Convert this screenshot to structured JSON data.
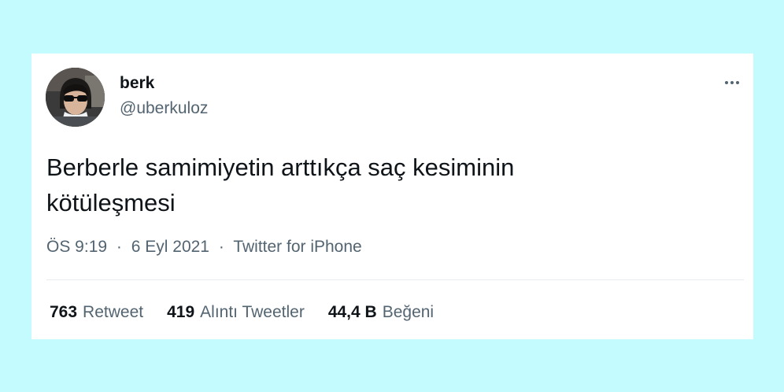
{
  "tweet": {
    "author": {
      "name": "berk",
      "handle": "@uberkuloz",
      "avatar_icon": "profile-photo"
    },
    "more_icon": "more-horizontal-icon",
    "text_line1": "Berberle samimiyetin arttıkça saç kesiminin",
    "text_line2": "kötüleşmesi",
    "meta": {
      "time": "ÖS 9:19",
      "separator": "·",
      "date": "6 Eyl 2021",
      "source": "Twitter for iPhone"
    },
    "stats": {
      "retweets": {
        "count": "763",
        "label": "Retweet"
      },
      "quotes": {
        "count": "419",
        "label": "Alıntı Tweetler"
      },
      "likes": {
        "count": "44,4 B",
        "label": "Beğeni"
      }
    }
  },
  "colors": {
    "background": "#c3fbff",
    "card": "#ffffff",
    "primary_text": "#0f1419",
    "secondary_text": "#536471"
  }
}
